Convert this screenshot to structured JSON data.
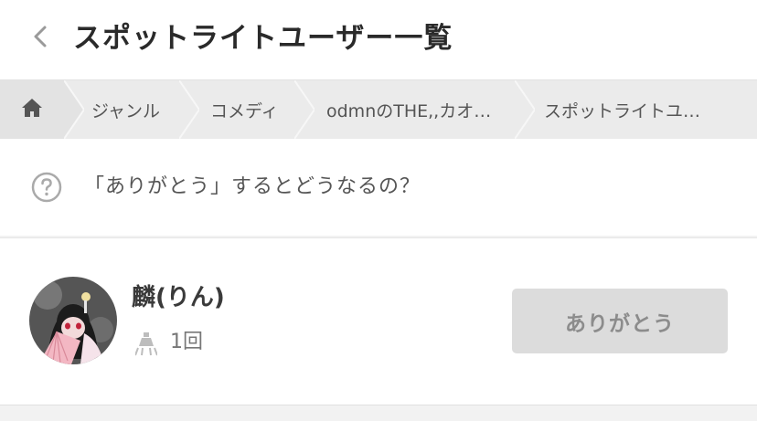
{
  "header": {
    "back_icon": "chevron-left-icon",
    "title": "スポットライトユーザー一覧"
  },
  "breadcrumb": {
    "home_icon": "home-icon",
    "items": [
      {
        "label": "ジャンル"
      },
      {
        "label": "コメディ"
      },
      {
        "label": "odmnのTHE,,カオ…"
      },
      {
        "label": "スポットライトユ…"
      }
    ]
  },
  "help": {
    "icon": "question-circle-icon",
    "text": "「ありがとう」するとどうなるの？"
  },
  "users": [
    {
      "name": "麟(りん)",
      "spotlight_icon": "spotlight-icon",
      "spotlight_count": "1回",
      "thanks_label": "ありがとう"
    }
  ],
  "colors": {
    "header_bg": "#ffffff",
    "breadcrumb_bg": "#ebebeb",
    "page_bg": "#f2f2f2",
    "button_bg": "#dcdcdc",
    "button_text": "#8c8c8c"
  }
}
